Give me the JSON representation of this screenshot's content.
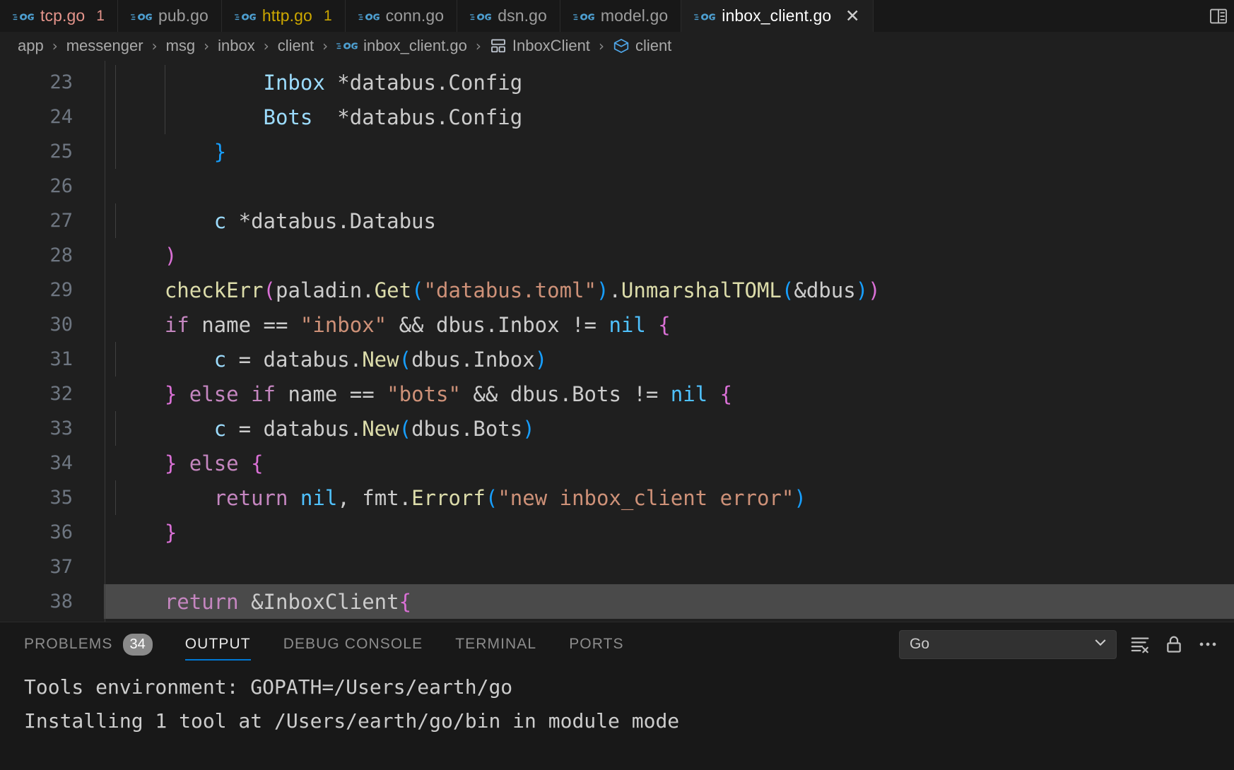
{
  "window": {
    "app": "Visual Studio Code",
    "theme_bg": "#1f1f1f"
  },
  "colors": {
    "editor_bg": "#1f1f1f",
    "tabbar_bg": "#181818",
    "accent": "#0078d4",
    "error": "#e4948b",
    "warning": "#cca700",
    "go_icon_blue": "#4d9ecf",
    "selection": "#4a4a4a"
  },
  "tabbar": {
    "tabs": [
      {
        "icon": "go-file-icon",
        "label": "tcp.go",
        "badge": "1",
        "state": "error",
        "active": false,
        "closable": false
      },
      {
        "icon": "go-file-icon",
        "label": "pub.go",
        "badge": "",
        "state": "normal",
        "active": false,
        "closable": false
      },
      {
        "icon": "go-file-icon",
        "label": "http.go",
        "badge": "1",
        "state": "warning",
        "active": false,
        "closable": false
      },
      {
        "icon": "go-file-icon",
        "label": "conn.go",
        "badge": "",
        "state": "normal",
        "active": false,
        "closable": false
      },
      {
        "icon": "go-file-icon",
        "label": "dsn.go",
        "badge": "",
        "state": "normal",
        "active": false,
        "closable": false
      },
      {
        "icon": "go-file-icon",
        "label": "model.go",
        "badge": "",
        "state": "normal",
        "active": false,
        "closable": false
      },
      {
        "icon": "go-file-icon",
        "label": "inbox_client.go",
        "badge": "",
        "state": "normal",
        "active": true,
        "closable": true,
        "close_glyph": "✕"
      }
    ],
    "actions": [
      {
        "icon": "split-editor-right-icon",
        "label": "Split Editor Right"
      }
    ]
  },
  "breadcrumb": {
    "separator": "›",
    "items": [
      {
        "label": "app",
        "icon": ""
      },
      {
        "label": "messenger",
        "icon": ""
      },
      {
        "label": "msg",
        "icon": ""
      },
      {
        "label": "inbox",
        "icon": ""
      },
      {
        "label": "client",
        "icon": ""
      },
      {
        "label": "inbox_client.go",
        "icon": "go-file-icon"
      },
      {
        "label": "InboxClient",
        "icon": "struct-symbol-icon"
      },
      {
        "label": "client",
        "icon": "package-symbol-icon"
      }
    ]
  },
  "editor": {
    "language": "go",
    "first_visible_line": 23,
    "selected_line": 38,
    "lines": [
      {
        "n": "23",
        "indent_guides": 2,
        "tokens": [
          {
            "t": "            ",
            "c": "t-plain"
          },
          {
            "t": "Inbox",
            "c": "t-var"
          },
          {
            "t": " *databus.Config",
            "c": "t-plain"
          }
        ]
      },
      {
        "n": "24",
        "indent_guides": 2,
        "tokens": [
          {
            "t": "            ",
            "c": "t-plain"
          },
          {
            "t": "Bots",
            "c": "t-var"
          },
          {
            "t": "  *databus.Config",
            "c": "t-plain"
          }
        ]
      },
      {
        "n": "25",
        "indent_guides": 1,
        "tokens": [
          {
            "t": "        ",
            "c": "t-plain"
          },
          {
            "t": "}",
            "c": "t-brb"
          }
        ]
      },
      {
        "n": "26",
        "indent_guides": 0,
        "tokens": []
      },
      {
        "n": "27",
        "indent_guides": 1,
        "tokens": [
          {
            "t": "        ",
            "c": "t-plain"
          },
          {
            "t": "c",
            "c": "t-var"
          },
          {
            "t": " *databus.Databus",
            "c": "t-plain"
          }
        ]
      },
      {
        "n": "28",
        "indent_guides": 0,
        "tokens": [
          {
            "t": "    ",
            "c": "t-plain"
          },
          {
            "t": ")",
            "c": "t-brp"
          }
        ]
      },
      {
        "n": "29",
        "indent_guides": 0,
        "tokens": [
          {
            "t": "    ",
            "c": "t-plain"
          },
          {
            "t": "checkErr",
            "c": "t-func"
          },
          {
            "t": "(",
            "c": "t-brp"
          },
          {
            "t": "paladin",
            "c": "t-plain"
          },
          {
            "t": ".",
            "c": "t-plain"
          },
          {
            "t": "Get",
            "c": "t-func"
          },
          {
            "t": "(",
            "c": "t-brb"
          },
          {
            "t": "\"databus.toml\"",
            "c": "t-str"
          },
          {
            "t": ")",
            "c": "t-brb"
          },
          {
            "t": ".",
            "c": "t-plain"
          },
          {
            "t": "UnmarshalTOML",
            "c": "t-func"
          },
          {
            "t": "(",
            "c": "t-brb"
          },
          {
            "t": "&dbus",
            "c": "t-plain"
          },
          {
            "t": ")",
            "c": "t-brb"
          },
          {
            "t": ")",
            "c": "t-brp"
          }
        ]
      },
      {
        "n": "30",
        "indent_guides": 0,
        "tokens": [
          {
            "t": "    ",
            "c": "t-plain"
          },
          {
            "t": "if",
            "c": "t-kw"
          },
          {
            "t": " name ",
            "c": "t-plain"
          },
          {
            "t": "==",
            "c": "t-op"
          },
          {
            "t": " ",
            "c": "t-plain"
          },
          {
            "t": "\"inbox\"",
            "c": "t-str"
          },
          {
            "t": " && dbus.Inbox ",
            "c": "t-plain"
          },
          {
            "t": "!=",
            "c": "t-op"
          },
          {
            "t": " ",
            "c": "t-plain"
          },
          {
            "t": "nil",
            "c": "t-type"
          },
          {
            "t": " ",
            "c": "t-plain"
          },
          {
            "t": "{",
            "c": "t-brp"
          }
        ]
      },
      {
        "n": "31",
        "indent_guides": 1,
        "tokens": [
          {
            "t": "        ",
            "c": "t-plain"
          },
          {
            "t": "c",
            "c": "t-var"
          },
          {
            "t": " = databus.",
            "c": "t-plain"
          },
          {
            "t": "New",
            "c": "t-func"
          },
          {
            "t": "(",
            "c": "t-brb"
          },
          {
            "t": "dbus.Inbox",
            "c": "t-plain"
          },
          {
            "t": ")",
            "c": "t-brb"
          }
        ]
      },
      {
        "n": "32",
        "indent_guides": 0,
        "tokens": [
          {
            "t": "    ",
            "c": "t-plain"
          },
          {
            "t": "}",
            "c": "t-brp"
          },
          {
            "t": " ",
            "c": "t-plain"
          },
          {
            "t": "else",
            "c": "t-kw"
          },
          {
            "t": " ",
            "c": "t-plain"
          },
          {
            "t": "if",
            "c": "t-kw"
          },
          {
            "t": " name ",
            "c": "t-plain"
          },
          {
            "t": "==",
            "c": "t-op"
          },
          {
            "t": " ",
            "c": "t-plain"
          },
          {
            "t": "\"bots\"",
            "c": "t-str"
          },
          {
            "t": " && dbus.Bots ",
            "c": "t-plain"
          },
          {
            "t": "!=",
            "c": "t-op"
          },
          {
            "t": " ",
            "c": "t-plain"
          },
          {
            "t": "nil",
            "c": "t-type"
          },
          {
            "t": " ",
            "c": "t-plain"
          },
          {
            "t": "{",
            "c": "t-brp"
          }
        ]
      },
      {
        "n": "33",
        "indent_guides": 1,
        "tokens": [
          {
            "t": "        ",
            "c": "t-plain"
          },
          {
            "t": "c",
            "c": "t-var"
          },
          {
            "t": " = databus.",
            "c": "t-plain"
          },
          {
            "t": "New",
            "c": "t-func"
          },
          {
            "t": "(",
            "c": "t-brb"
          },
          {
            "t": "dbus.Bots",
            "c": "t-plain"
          },
          {
            "t": ")",
            "c": "t-brb"
          }
        ]
      },
      {
        "n": "34",
        "indent_guides": 0,
        "tokens": [
          {
            "t": "    ",
            "c": "t-plain"
          },
          {
            "t": "}",
            "c": "t-brp"
          },
          {
            "t": " ",
            "c": "t-plain"
          },
          {
            "t": "else",
            "c": "t-kw"
          },
          {
            "t": " ",
            "c": "t-plain"
          },
          {
            "t": "{",
            "c": "t-brp"
          }
        ]
      },
      {
        "n": "35",
        "indent_guides": 1,
        "tokens": [
          {
            "t": "        ",
            "c": "t-plain"
          },
          {
            "t": "return",
            "c": "t-kw"
          },
          {
            "t": " ",
            "c": "t-plain"
          },
          {
            "t": "nil",
            "c": "t-type"
          },
          {
            "t": ", fmt.",
            "c": "t-plain"
          },
          {
            "t": "Errorf",
            "c": "t-func"
          },
          {
            "t": "(",
            "c": "t-brb"
          },
          {
            "t": "\"new inbox_client error\"",
            "c": "t-str"
          },
          {
            "t": ")",
            "c": "t-brb"
          }
        ]
      },
      {
        "n": "36",
        "indent_guides": 0,
        "tokens": [
          {
            "t": "    ",
            "c": "t-plain"
          },
          {
            "t": "}",
            "c": "t-brp"
          }
        ]
      },
      {
        "n": "37",
        "indent_guides": 0,
        "tokens": []
      },
      {
        "n": "38",
        "indent_guides": 0,
        "selected": true,
        "tokens": [
          {
            "t": "    ",
            "c": "t-plain"
          },
          {
            "t": "return",
            "c": "t-kw"
          },
          {
            "t": " &InboxClient",
            "c": "t-plain"
          },
          {
            "t": "{",
            "c": "t-brp"
          }
        ]
      }
    ]
  },
  "panel": {
    "tabs": [
      {
        "label": "PROBLEMS",
        "count": "34",
        "active": false
      },
      {
        "label": "OUTPUT",
        "count": "",
        "active": true
      },
      {
        "label": "DEBUG CONSOLE",
        "count": "",
        "active": false
      },
      {
        "label": "TERMINAL",
        "count": "",
        "active": false
      },
      {
        "label": "PORTS",
        "count": "",
        "active": false
      }
    ],
    "channel_select": {
      "value": "Go",
      "chevron": "chevron-down-icon"
    },
    "actions": [
      {
        "icon": "clear-output-icon",
        "label": "Clear Output"
      },
      {
        "icon": "lock-icon",
        "label": "Turn Auto Scrolling Off"
      },
      {
        "icon": "more-actions-icon",
        "label": "Views and More Actions..."
      }
    ],
    "output_lines": [
      "Tools environment: GOPATH=/Users/earth/go",
      "Installing 1 tool at /Users/earth/go/bin in module mode"
    ]
  }
}
